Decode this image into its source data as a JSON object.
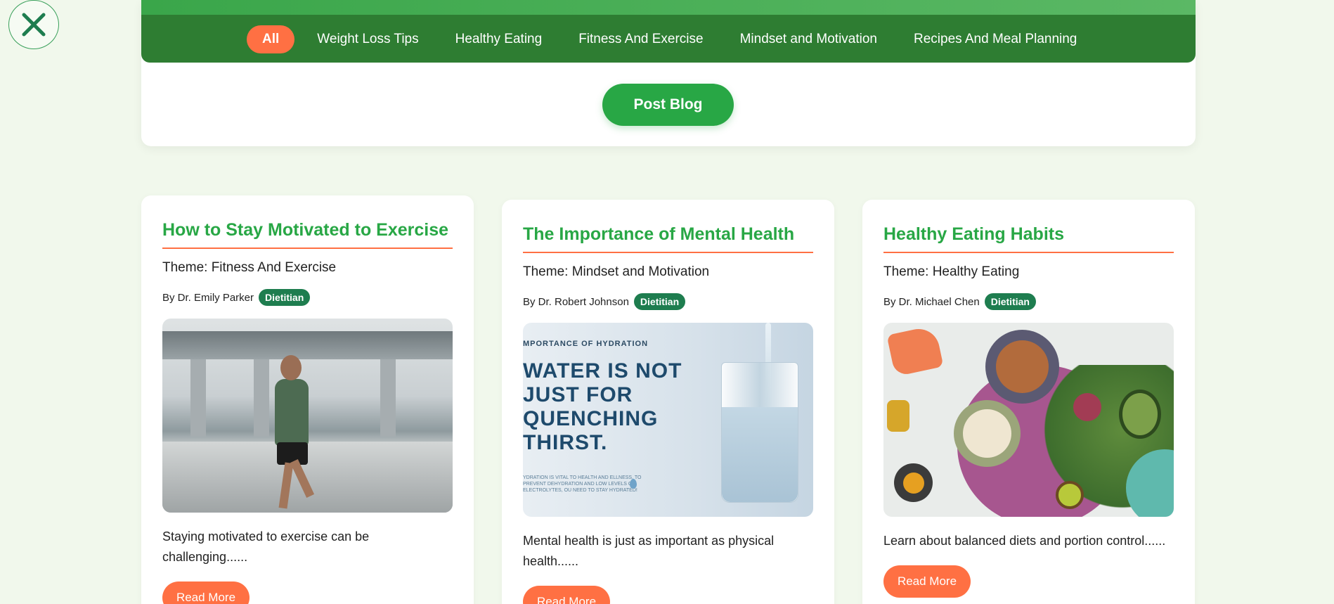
{
  "close_button": {
    "icon": "close-icon"
  },
  "nav": {
    "items": [
      {
        "label": "All",
        "active": true
      },
      {
        "label": "Weight Loss Tips",
        "active": false
      },
      {
        "label": "Healthy Eating",
        "active": false
      },
      {
        "label": "Fitness And Exercise",
        "active": false
      },
      {
        "label": "Mindset and Motivation",
        "active": false
      },
      {
        "label": "Recipes And Meal Planning",
        "active": false
      }
    ]
  },
  "post_blog_label": "Post Blog",
  "cards": [
    {
      "title": "How to Stay Motivated to Exercise",
      "theme": "Theme: Fitness And Exercise",
      "author": "By Dr. Emily Parker",
      "badge": "Dietitian",
      "excerpt": "Staying motivated to exercise can be challenging......",
      "read_more": "Read More"
    },
    {
      "title": "The Importance of Mental Health",
      "theme": "Theme: Mindset and Motivation",
      "author": "By Dr. Robert Johnson",
      "badge": "Dietitian",
      "excerpt": "Mental health is just as important as physical health......",
      "read_more": "Read More",
      "image_text": {
        "small": "MPORTANCE OF HYDRATION",
        "big_lines": [
          "WATER IS NOT",
          "JUST FOR",
          "QUENCHING",
          "THIRST."
        ],
        "tiny": "YDRATION IS VITAL TO HEALTH AND ELLNESS. TO PREVENT DEHYDRATION AND LOW LEVELS OF ELECTROLYTES, OU NEED TO STAY HYDRATED!"
      }
    },
    {
      "title": "Healthy Eating Habits",
      "theme": "Theme: Healthy Eating",
      "author": "By Dr. Michael Chen",
      "badge": "Dietitian",
      "excerpt": "Learn about balanced diets and portion control......",
      "read_more": "Read More"
    }
  ],
  "colors": {
    "primary_green": "#28a745",
    "nav_green": "#2e7d32",
    "accent_orange": "#ff7043",
    "badge_green": "#1e7d4f",
    "page_bg": "#f1f8ec"
  }
}
